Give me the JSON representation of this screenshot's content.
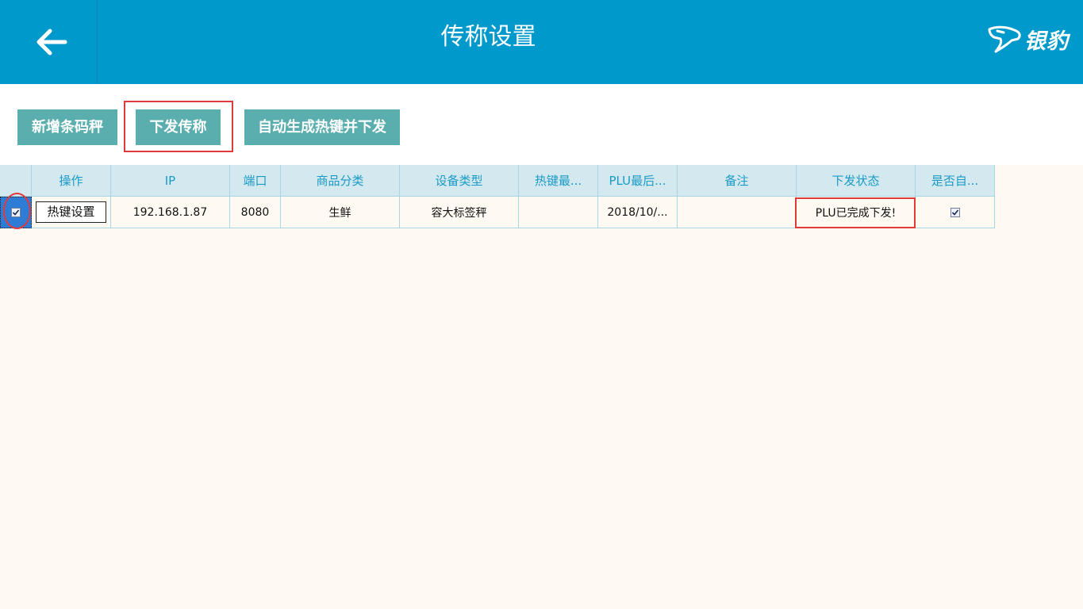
{
  "header": {
    "back_icon": "arrow-left-icon",
    "title": "传称设置",
    "logo_text": "银豹",
    "logo_icon": "leopard-head-icon"
  },
  "toolbar": {
    "add_scale_label": "新增条码秤",
    "send_scale_label": "下发传称",
    "auto_hotkey_label": "自动生成热键并下发"
  },
  "table": {
    "columns": [
      "",
      "操作",
      "IP",
      "端口",
      "商品分类",
      "设备类型",
      "热键最...",
      "PLU最后...",
      "备注",
      "下发状态",
      "是否自..."
    ],
    "rows": [
      {
        "selected": true,
        "action_label": "热键设置",
        "ip": "192.168.1.87",
        "port": "8080",
        "category": "生鲜",
        "device_type": "容大标签秤",
        "hotkey_last": "",
        "plu_last": "2018/10/...",
        "remark": "",
        "status": "PLU已完成下发!",
        "auto": true
      }
    ]
  },
  "colors": {
    "header_bg": "#0099cc",
    "button_bg": "#5aaeae",
    "highlight": "#e03a3a",
    "grid_header_bg": "#d3e9ef",
    "grid_header_text": "#1a9ac6",
    "page_bg": "#fefaf2"
  }
}
